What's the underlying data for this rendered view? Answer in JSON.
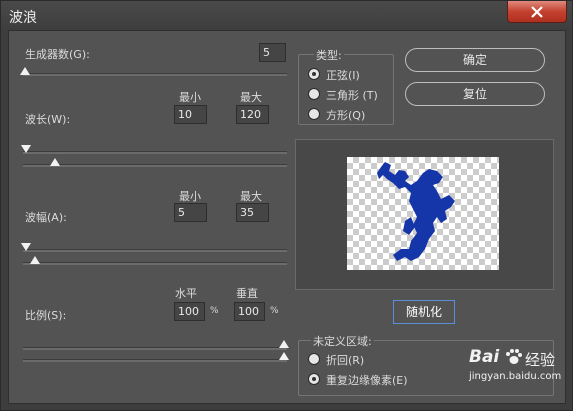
{
  "window": {
    "title": "波浪"
  },
  "generators": {
    "label": "生成器数(G):",
    "value": "5",
    "level": 0.0
  },
  "wavelength": {
    "label": "波长(W):",
    "min_header": "最小",
    "max_header": "最大",
    "min_value": "10",
    "max_value": "120"
  },
  "amplitude": {
    "label": "波幅(A):",
    "min_header": "最小",
    "max_header": "最大",
    "min_value": "5",
    "max_value": "35"
  },
  "scale": {
    "label": "比例(S):",
    "h_header": "水平",
    "v_header": "垂直",
    "h_value": "100",
    "v_value": "100",
    "percent": "%"
  },
  "type_group": {
    "title": "类型:",
    "options": [
      "正弦(I)",
      "三角形 (T)",
      "方形(Q)"
    ],
    "selected": 0
  },
  "buttons": {
    "ok": "确定",
    "reset": "复位",
    "randomize": "随机化"
  },
  "undefined_area": {
    "title": "未定义区域:",
    "options": [
      "折回(R)",
      "重复边缘像素(E)"
    ],
    "selected": 1
  },
  "watermark": {
    "brand": "Bai",
    "brand2": "经验",
    "url": "jingyan.baidu.com"
  },
  "colors": {
    "preview_shape": "#1436a8",
    "close_button": "#c3412f",
    "focus_border": "#5b8fd4"
  }
}
